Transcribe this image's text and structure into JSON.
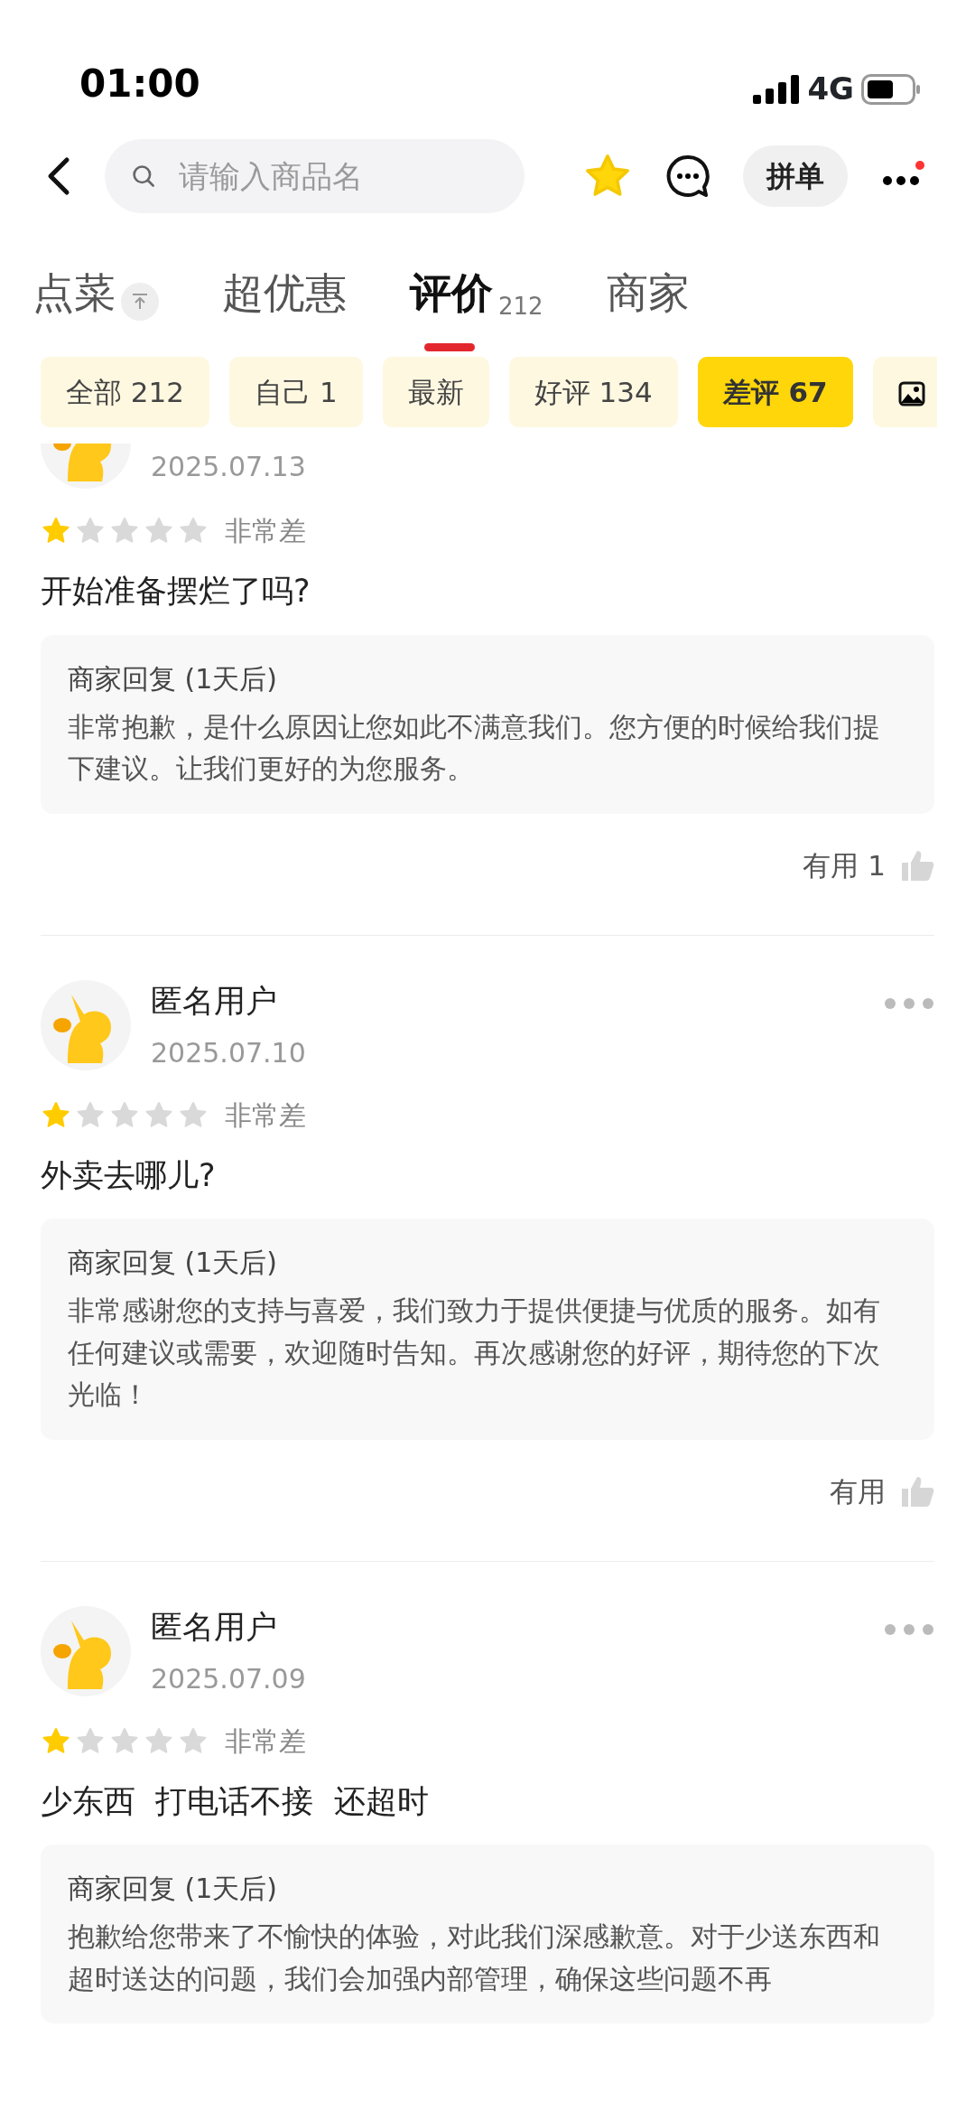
{
  "status_bar": {
    "time": "01:00",
    "network": "4G"
  },
  "header": {
    "search": {
      "placeholder": "请输入商品名"
    },
    "favorited": true,
    "group_button": "拼单",
    "more_badge": true
  },
  "tabs": [
    {
      "label": "点菜",
      "pin": true,
      "selected": false
    },
    {
      "label": "超优惠",
      "selected": false
    },
    {
      "label": "评价",
      "count": "212",
      "selected": true
    },
    {
      "label": "商家",
      "selected": false
    }
  ],
  "filters": [
    {
      "kind": "text",
      "label": "全部 212",
      "selected": false
    },
    {
      "kind": "text",
      "label": "自己 1",
      "selected": false
    },
    {
      "kind": "text",
      "label": "最新",
      "selected": false
    },
    {
      "kind": "text",
      "label": "好评 134",
      "selected": false
    },
    {
      "kind": "text",
      "label": "差评 67",
      "selected": true
    },
    {
      "kind": "image",
      "selected": false
    }
  ],
  "reviews": [
    {
      "date": "2025.07.13",
      "stars": 1,
      "rating": "非常差",
      "text": "开始准备摆烂了吗?",
      "reply_title": "商家回复 (1天后)",
      "reply": "非常抱歉，是什么原因让您如此不满意我们。您方便的时候给我们提下建议。让我们更好的为您服务。",
      "useful": "有用 1"
    },
    {
      "user": "匿名用户",
      "date": "2025.07.10",
      "stars": 1,
      "rating": "非常差",
      "text": "外卖去哪儿?",
      "reply_title": "商家回复 (1天后)",
      "reply": "非常感谢您的支持与喜爱，我们致力于提供便捷与优质的服务。如有任何建议或需要，欢迎随时告知。再次感谢您的好评，期待您的下次光临！",
      "useful": "有用"
    },
    {
      "user": "匿名用户",
      "date": "2025.07.09",
      "stars": 1,
      "rating": "非常差",
      "text": "少东西  打电话不接  还超时",
      "reply_title": "商家回复 (1天后)",
      "reply": "抱歉给您带来了不愉快的体验，对此我们深感歉意。对于少送东西和超时送达的问题，我们会加强内部管理，确保这些问题不再"
    }
  ]
}
